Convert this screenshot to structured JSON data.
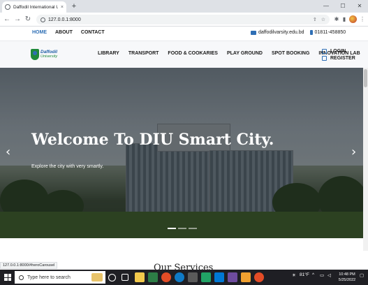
{
  "browser": {
    "tab_title": "Daffodil International University",
    "tab_close": "×",
    "newtab": "+",
    "url": "127.0.0.1:8000",
    "nav_back": "←",
    "nav_forward": "→",
    "nav_reload": "↻",
    "minimize": "—",
    "maximize": "☐",
    "close": "✕",
    "status_url": "127.0.0.1:8000/#heroCarousel"
  },
  "topbar": {
    "links": [
      "HOME",
      "ABOUT",
      "CONTACT"
    ],
    "email": "daffodilvarsity.edu.bd",
    "phone": "01811-458850"
  },
  "logo": {
    "line1": "Daffodil",
    "line2": "University"
  },
  "menu": [
    "LIBRARY",
    "TRANSPORT",
    "FOOD & COOKARIES",
    "PLAY GROUND",
    "SPOT BOOKING",
    "INNOVATION LAB"
  ],
  "auth": {
    "login": "LOGIN",
    "register": "REGISTER"
  },
  "hero": {
    "title": "Welcome To DIU Smart City.",
    "subtitle": "Explore the city with very smartly.",
    "prev": "‹",
    "next": "›",
    "slide_count": 3,
    "active_slide": 1
  },
  "section": {
    "services_title": "Our Services"
  },
  "taskbar": {
    "search_placeholder": "Type here to search",
    "temperature": "81°F",
    "time": "10:48 PM",
    "date": "5/25/2022"
  },
  "colors": {
    "accent": "#2f6fb5",
    "brand_green": "#1f8a3b",
    "taskbar": "#1f1f24"
  }
}
